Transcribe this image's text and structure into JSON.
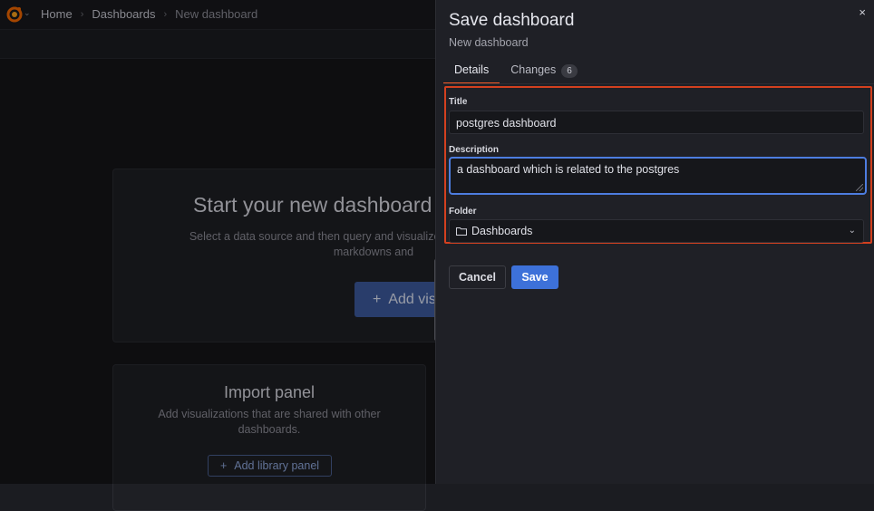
{
  "breadcrumb": {
    "items": [
      "Home",
      "Dashboards",
      "New dashboard"
    ]
  },
  "empty_state": {
    "title": "Start your new dashboard",
    "description": "Select a data source and then query and visualize y",
    "description2": "markdowns and",
    "add_button": "Add vis"
  },
  "import_panel": {
    "title": "Import panel",
    "description": "Add visualizations that are shared with other dashboards.",
    "button": "Add library panel"
  },
  "drawer": {
    "title": "Save dashboard",
    "subtitle": "New dashboard",
    "close_icon": "×",
    "tabs": [
      {
        "label": "Details",
        "active": true
      },
      {
        "label": "Changes",
        "count": "6"
      }
    ],
    "form": {
      "title_label": "Title",
      "title_value": "postgres dashboard",
      "description_label": "Description",
      "description_value": "a dashboard which is related to the postgres",
      "folder_label": "Folder",
      "folder_value": "Dashboards"
    },
    "cancel_label": "Cancel",
    "save_label": "Save"
  },
  "colors": {
    "accent_blue": "#3d71d9",
    "tab_underline": "#f05a28",
    "highlight_border": "#d3401f"
  }
}
